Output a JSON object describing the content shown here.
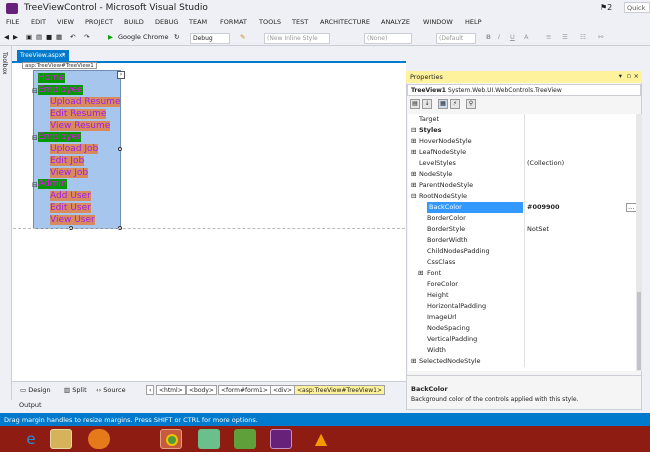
{
  "window": {
    "title": "TreeViewControl - Microsoft Visual Studio",
    "quick_launch": "Quick",
    "notif_count": "2"
  },
  "menu": [
    "FILE",
    "EDIT",
    "VIEW",
    "PROJECT",
    "BUILD",
    "DEBUG",
    "TEAM",
    "FORMAT",
    "TOOLS",
    "TEST",
    "ARCHITECTURE",
    "ANALYZE",
    "WINDOW",
    "HELP"
  ],
  "toolbar": {
    "browser": "Google Chrome",
    "config": "Debug",
    "style_box": "(New Inline Style",
    "none_box": "(None)",
    "default_box": "(Default"
  },
  "toolbox_label": "Toolbox",
  "doc_tab": "TreeView.aspx*",
  "control_tag": "asp:TreeView#TreeView1",
  "tree": {
    "roots": [
      {
        "label": "Home",
        "children": []
      },
      {
        "label": "Employee",
        "children": [
          "Upload Resume",
          "Edit Resume",
          "View Resume"
        ]
      },
      {
        "label": "Employer",
        "children": [
          "Upload Job",
          "Edit Job",
          "View Job"
        ]
      },
      {
        "label": "Admin",
        "children": [
          "Add User",
          "Edit User",
          "View User"
        ]
      }
    ],
    "root_color": "#009900"
  },
  "views": {
    "design": "Design",
    "split": "Split",
    "source": "Source"
  },
  "breadcrumbs": [
    "<html>",
    "<body>",
    "<form#form1>",
    "<div>",
    "<asp:TreeView#TreeView1>"
  ],
  "output_label": "Output",
  "status": "Drag margin handles to resize margins. Press SHIFT or CTRL for more options.",
  "properties": {
    "title": "Properties",
    "object": "TreeView1",
    "object_type": "System.Web.UI.WebControls.TreeView",
    "rows": [
      {
        "name": "Target",
        "value": "",
        "indent": 1,
        "exp": ""
      },
      {
        "name": "Styles",
        "value": "",
        "indent": 0,
        "exp": "⊟",
        "cat": true
      },
      {
        "name": "HoverNodeStyle",
        "value": "",
        "indent": 0,
        "exp": "⊞"
      },
      {
        "name": "LeafNodeStyle",
        "value": "",
        "indent": 0,
        "exp": "⊞"
      },
      {
        "name": "LevelStyles",
        "value": "(Collection)",
        "indent": 1,
        "exp": ""
      },
      {
        "name": "NodeStyle",
        "value": "",
        "indent": 0,
        "exp": "⊞"
      },
      {
        "name": "ParentNodeStyle",
        "value": "",
        "indent": 0,
        "exp": "⊞"
      },
      {
        "name": "RootNodeStyle",
        "value": "",
        "indent": 0,
        "exp": "⊟"
      },
      {
        "name": "BackColor",
        "value": "#009900",
        "indent": 2,
        "exp": "",
        "sel": true
      },
      {
        "name": "BorderColor",
        "value": "",
        "indent": 2,
        "exp": ""
      },
      {
        "name": "BorderStyle",
        "value": "NotSet",
        "indent": 2,
        "exp": ""
      },
      {
        "name": "BorderWidth",
        "value": "",
        "indent": 2,
        "exp": ""
      },
      {
        "name": "ChildNodesPadding",
        "value": "",
        "indent": 2,
        "exp": ""
      },
      {
        "name": "CssClass",
        "value": "",
        "indent": 2,
        "exp": ""
      },
      {
        "name": "Font",
        "value": "",
        "indent": 1,
        "exp": "⊞"
      },
      {
        "name": "ForeColor",
        "value": "",
        "indent": 2,
        "exp": ""
      },
      {
        "name": "Height",
        "value": "",
        "indent": 2,
        "exp": ""
      },
      {
        "name": "HorizontalPadding",
        "value": "",
        "indent": 2,
        "exp": ""
      },
      {
        "name": "ImageUrl",
        "value": "",
        "indent": 2,
        "exp": ""
      },
      {
        "name": "NodeSpacing",
        "value": "",
        "indent": 2,
        "exp": ""
      },
      {
        "name": "VerticalPadding",
        "value": "",
        "indent": 2,
        "exp": ""
      },
      {
        "name": "Width",
        "value": "",
        "indent": 2,
        "exp": ""
      },
      {
        "name": "SelectedNodeStyle",
        "value": "",
        "indent": 0,
        "exp": "⊞"
      }
    ],
    "desc_title": "BackColor",
    "desc_text": "Background color of the controls applied with this style."
  }
}
